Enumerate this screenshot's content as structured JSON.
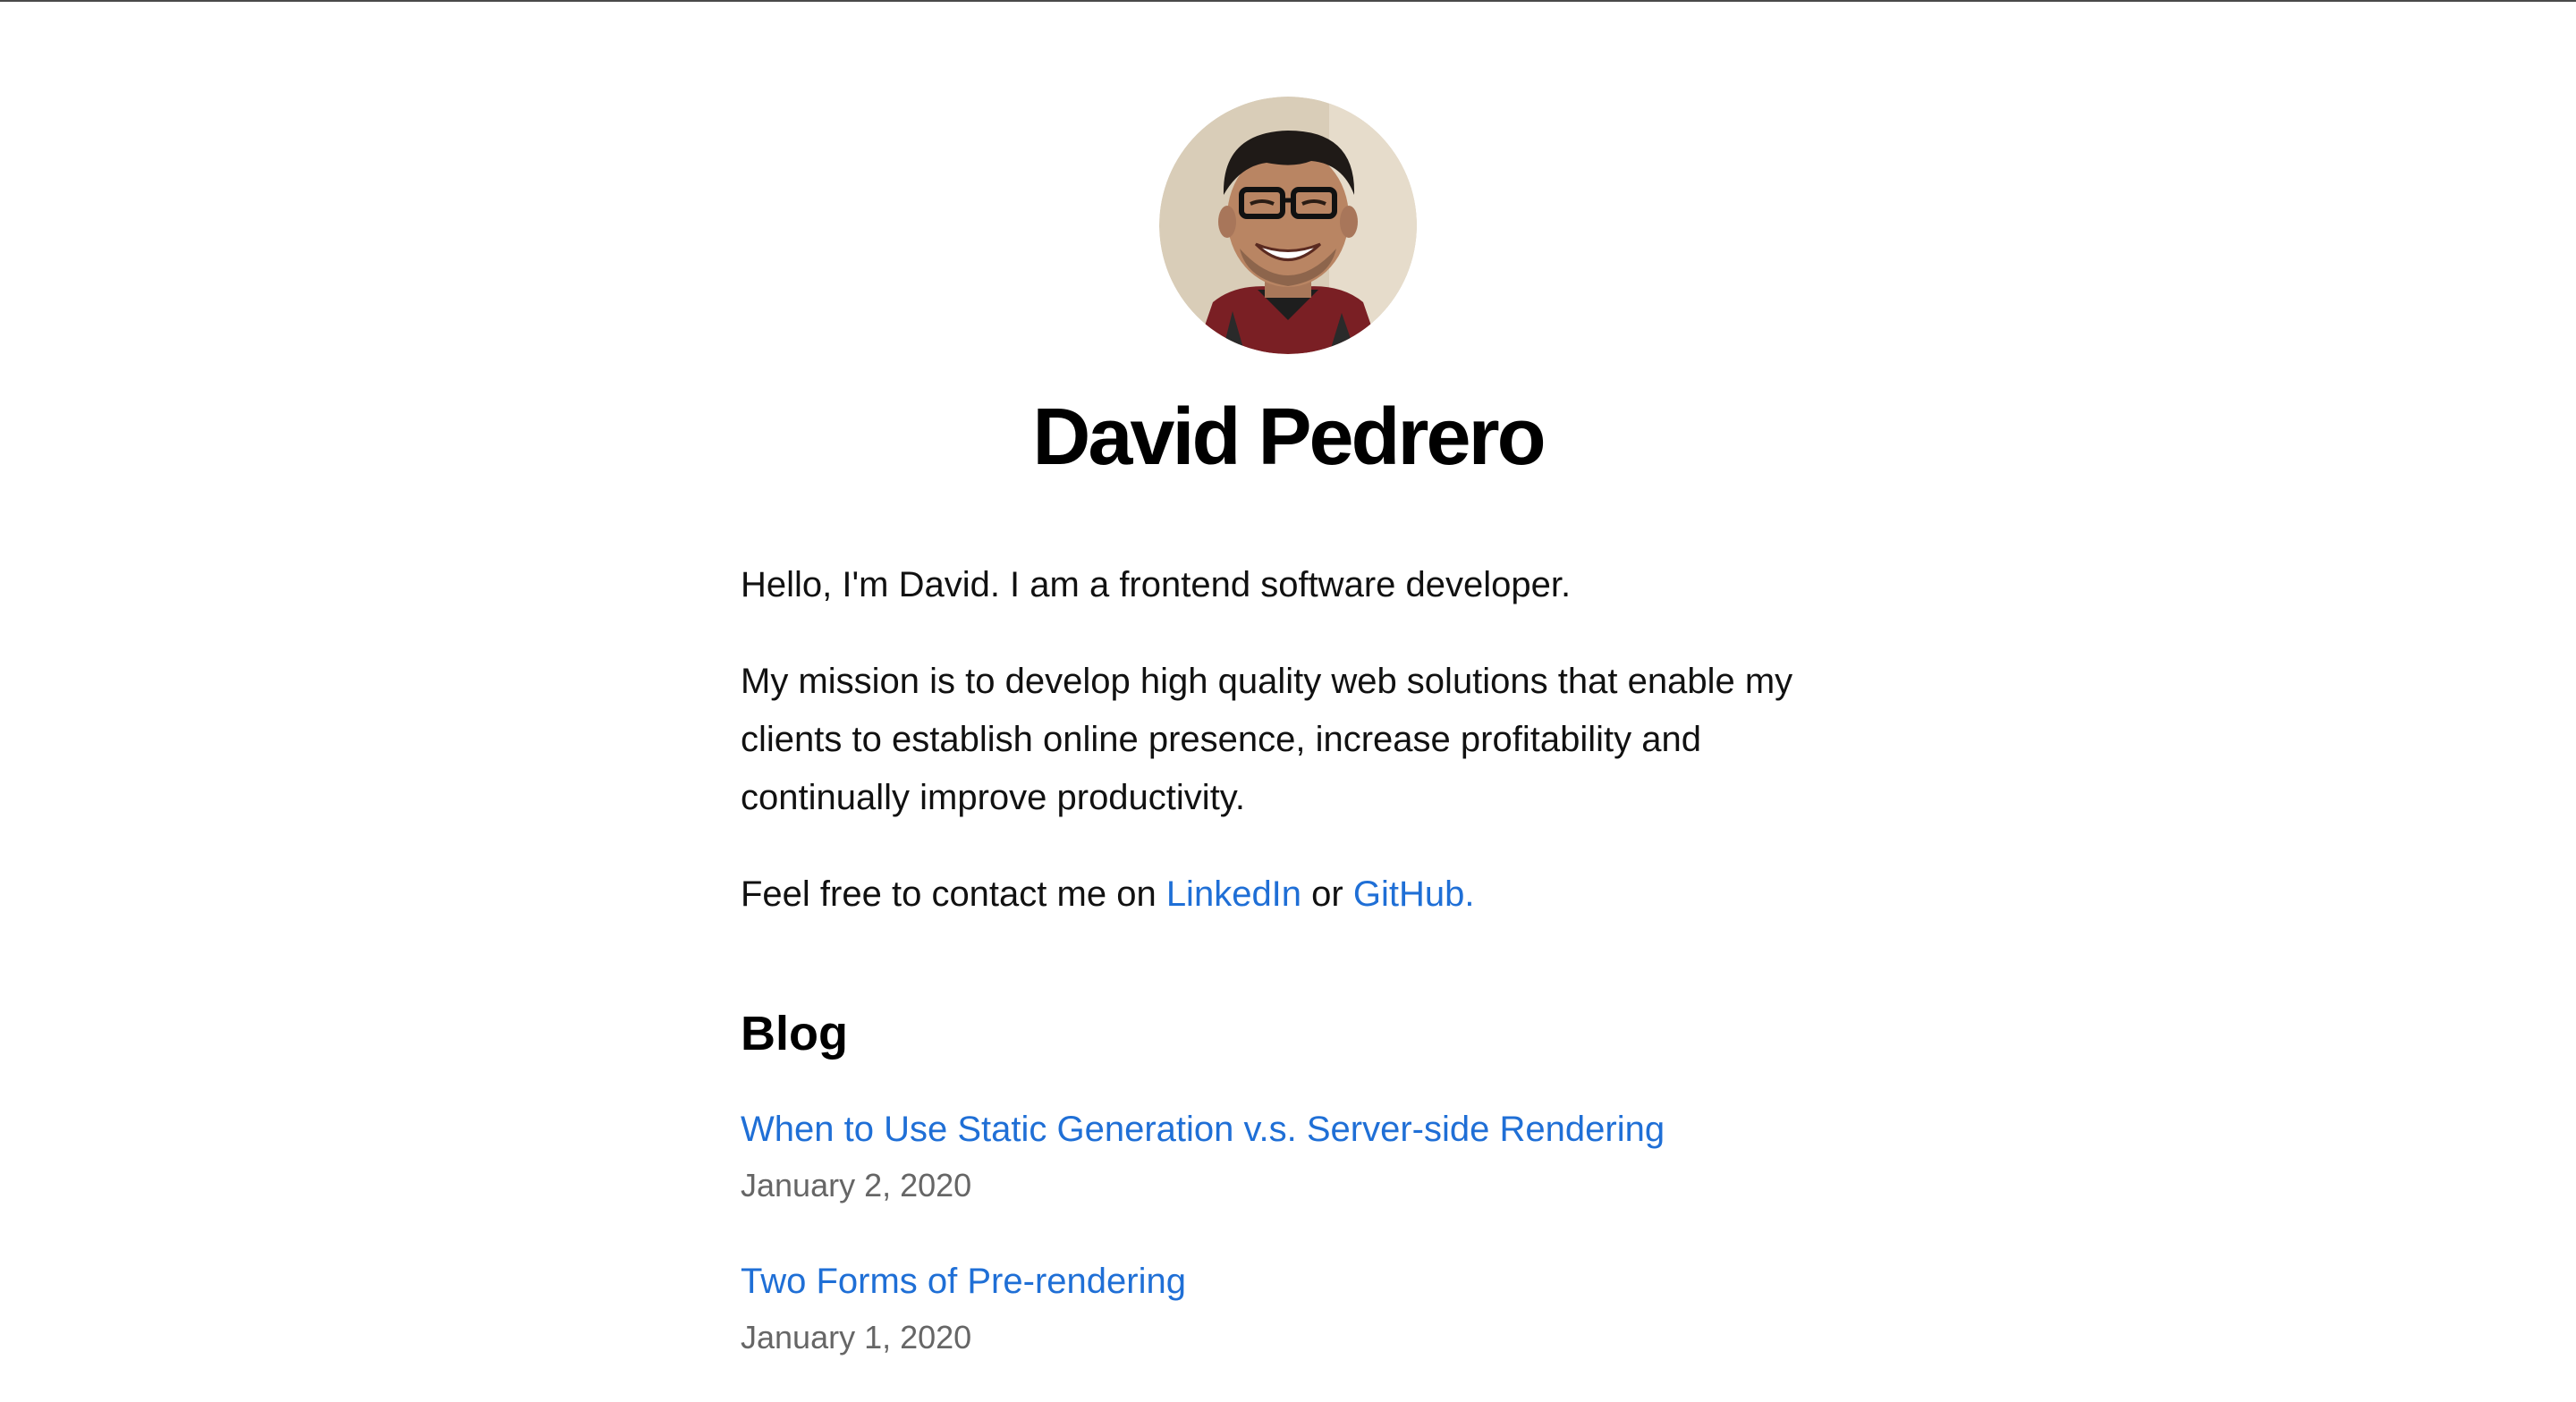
{
  "profile": {
    "name": "David Pedrero",
    "avatar_icon": "profile-photo"
  },
  "intro": "Hello, I'm David. I am a frontend software developer.",
  "mission": "My mission is to develop high quality web solutions that enable my clients to establish online presence, increase profitability and continually improve productivity.",
  "contact": {
    "prefix": "Feel free to contact me on ",
    "linkedin_label": "LinkedIn",
    "separator": " or ",
    "github_label": "GitHub."
  },
  "blog": {
    "heading": "Blog",
    "posts": [
      {
        "title": "When to Use Static Generation v.s. Server-side Rendering",
        "date": "January 2, 2020"
      },
      {
        "title": "Two Forms of Pre-rendering",
        "date": "January 1, 2020"
      }
    ]
  },
  "colors": {
    "link": "#1f6fd6",
    "date": "#666666",
    "text": "#111111"
  }
}
